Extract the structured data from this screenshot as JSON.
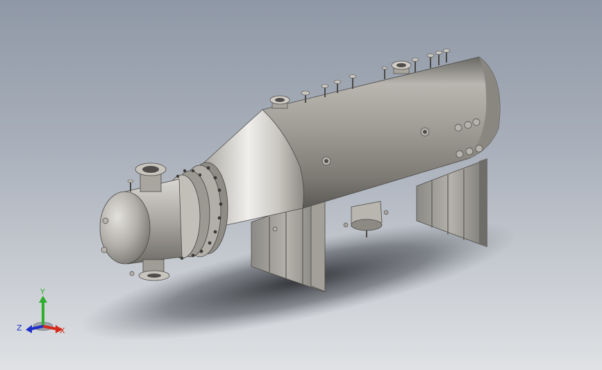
{
  "model": {
    "name": "",
    "kind": "pressure-vessel-assembly"
  },
  "triad": {
    "x_label": "X",
    "y_label": "Y",
    "z_label": "Z",
    "x_color": "#d42a1e",
    "y_color": "#2fae2f",
    "z_color": "#1f2fc8"
  },
  "colors": {
    "background_top": "#8f98a6",
    "background_bottom": "#dfe1e4",
    "metal_light": "#d8d6d2",
    "metal_mid": "#a8a59f",
    "metal_dark": "#5e5c58"
  }
}
